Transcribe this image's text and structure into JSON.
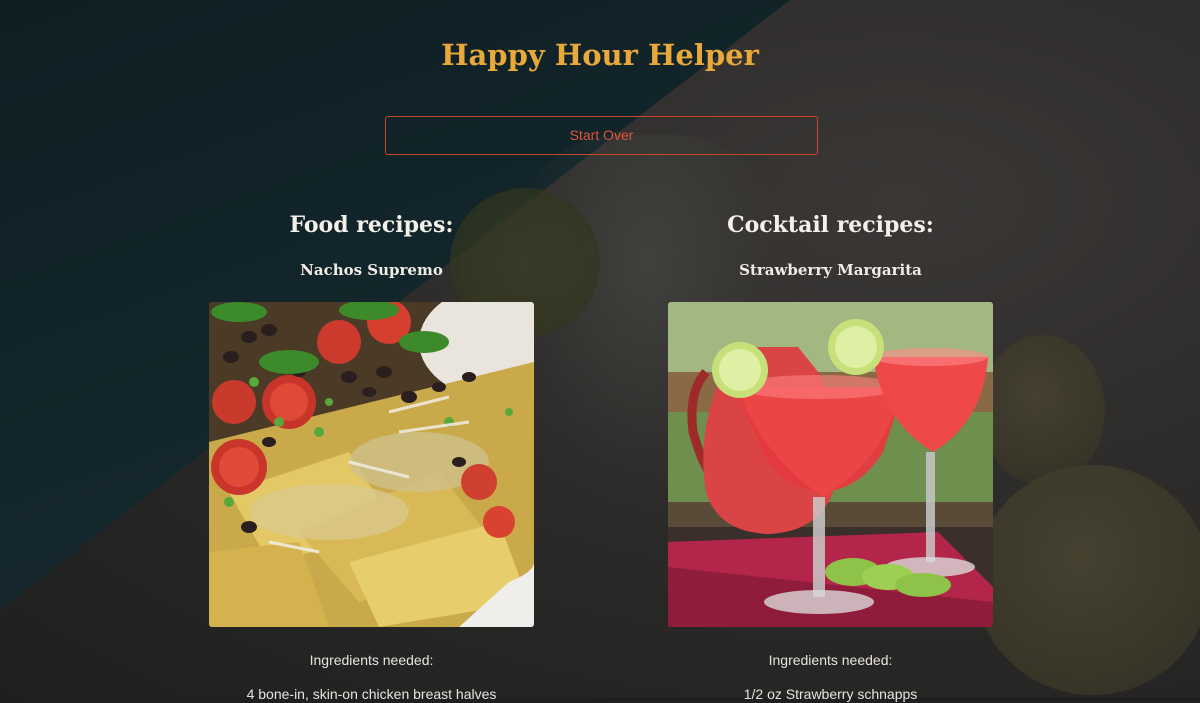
{
  "page": {
    "title": "Happy Hour Helper",
    "start_over_label": "Start Over"
  },
  "food": {
    "heading": "Food recipes:",
    "recipe_name": "Nachos Supremo",
    "ingredients_label": "Ingredients needed:",
    "ingredients": [
      "4 bone-in, skin-on chicken breast halves"
    ]
  },
  "cocktail": {
    "heading": "Cocktail recipes:",
    "recipe_name": "Strawberry Margarita",
    "ingredients_label": "Ingredients needed:",
    "ingredients": [
      "1/2 oz Strawberry schnapps"
    ]
  },
  "colors": {
    "title": "#e8a83a",
    "button_border": "#c9462a",
    "button_text": "#e0543a"
  }
}
